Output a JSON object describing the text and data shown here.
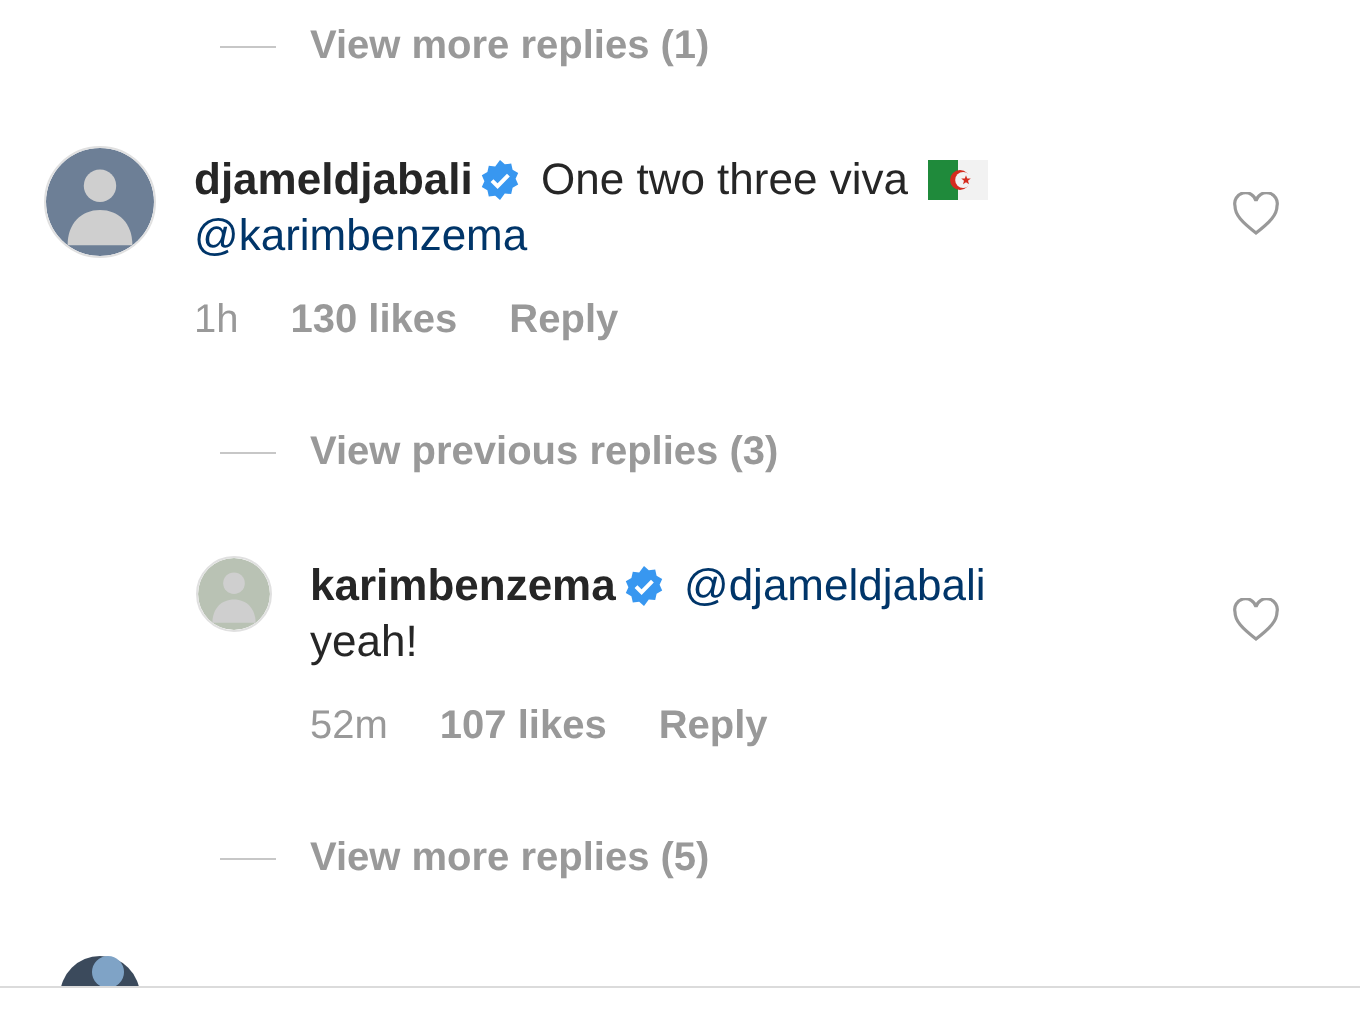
{
  "thread": [
    {
      "kind": "view_replies",
      "label": "View more replies (1)"
    },
    {
      "kind": "comment",
      "username": "djameldjabali",
      "verified": true,
      "liked": false,
      "parts": [
        {
          "kind": "text",
          "text": "One two three viva"
        },
        {
          "kind": "flag"
        },
        {
          "kind": "mention",
          "text": "@karimbenzema"
        }
      ],
      "time": "1h",
      "likes": "130 likes",
      "reply": "Reply",
      "replies": [
        {
          "kind": "view_replies",
          "label": "View previous replies (3)"
        },
        {
          "kind": "comment",
          "username": "karimbenzema",
          "verified": true,
          "liked": false,
          "parts": [
            {
              "kind": "mention",
              "text": "@djameldjabali"
            },
            {
              "kind": "text",
              "text": "yeah!"
            }
          ],
          "time": "52m",
          "likes": "107 likes",
          "reply": "Reply"
        },
        {
          "kind": "view_replies",
          "label": "View more replies (5)"
        }
      ]
    },
    {
      "kind": "cut_comment"
    }
  ]
}
